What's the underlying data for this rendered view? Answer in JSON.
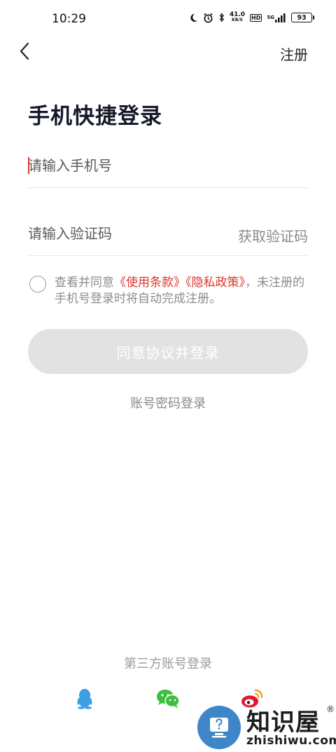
{
  "status_bar": {
    "time": "10:29",
    "net_speed": "41.0",
    "net_speed_unit": "KB/S",
    "hd_label": "HD",
    "signal_label": "5G",
    "battery_level": "93"
  },
  "header": {
    "register_label": "注册"
  },
  "title": "手机快捷登录",
  "phone_field": {
    "placeholder": "请输入手机号",
    "value": ""
  },
  "code_field": {
    "placeholder": "请输入验证码",
    "value": ""
  },
  "get_code_label": "获取验证码",
  "agreement": {
    "checked": false,
    "prefix": "查看并同意",
    "terms_link": "《使用条款》",
    "privacy_link": "《隐私政策》",
    "suffix": "，未注册的手机号登录时将自动完成注册。"
  },
  "login_button_label": "同意协议并登录",
  "password_login_label": "账号密码登录",
  "third_party": {
    "title": "第三方账号登录",
    "providers": [
      "qq-icon",
      "wechat-icon",
      "weibo-icon"
    ]
  },
  "watermark": {
    "title": "知识屋",
    "registered_mark": "®",
    "domain": "zhishiwu.com"
  },
  "colors": {
    "accent_red": "#d9382d",
    "button_disabled": "#e2e2e2",
    "qq_blue": "#3d9ee3",
    "wechat_green": "#3cbf3f",
    "weibo_red": "#e6162d"
  }
}
